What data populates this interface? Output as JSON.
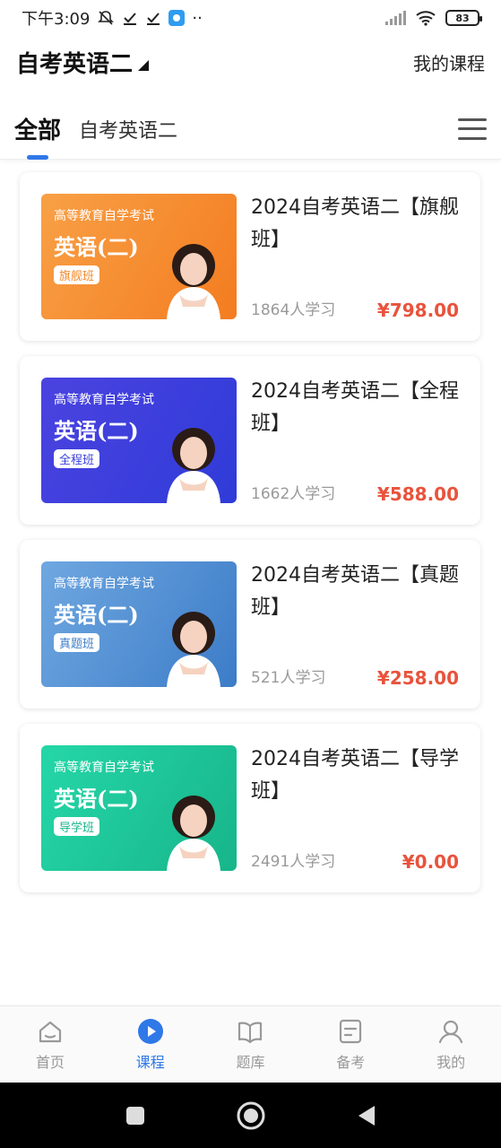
{
  "status_bar": {
    "time": "下午3:09",
    "dots": "··",
    "battery": "83"
  },
  "header": {
    "title": "自考英语二",
    "my_course": "我的课程"
  },
  "tabs": [
    {
      "label": "全部",
      "active": true
    },
    {
      "label": "自考英语二",
      "active": false
    }
  ],
  "courses": [
    {
      "title": "2024自考英语二【旗舰班】",
      "students": "1864人学习",
      "price": "¥798.00",
      "thumb": {
        "line1": "高等教育自学考试",
        "line2": "英语(二)",
        "tag": "旗舰班",
        "theme": "#f48a2a"
      }
    },
    {
      "title": "2024自考英语二【全程班】",
      "students": "1662人学习",
      "price": "¥588.00",
      "thumb": {
        "line1": "高等教育自学考试",
        "line2": "英语(二)",
        "tag": "全程班",
        "theme": "#3a3fdc"
      }
    },
    {
      "title": "2024自考英语二【真题班】",
      "students": "521人学习",
      "price": "¥258.00",
      "thumb": {
        "line1": "高等教育自学考试",
        "line2": "英语(二)",
        "tag": "真题班",
        "theme": "#4f8fd4"
      }
    },
    {
      "title": "2024自考英语二【导学班】",
      "students": "2491人学习",
      "price": "¥0.00",
      "thumb": {
        "line1": "高等教育自学考试",
        "line2": "英语(二)",
        "tag": "导学班",
        "theme": "#1fc79a"
      }
    }
  ],
  "bottom_nav": [
    {
      "label": "首页",
      "icon": "home-icon",
      "active": false
    },
    {
      "label": "课程",
      "icon": "play-icon",
      "active": true
    },
    {
      "label": "题库",
      "icon": "book-icon",
      "active": false
    },
    {
      "label": "备考",
      "icon": "notes-icon",
      "active": false
    },
    {
      "label": "我的",
      "icon": "user-icon",
      "active": false
    }
  ],
  "colors": {
    "accent": "#2f78e8",
    "price": "#e8533c"
  }
}
